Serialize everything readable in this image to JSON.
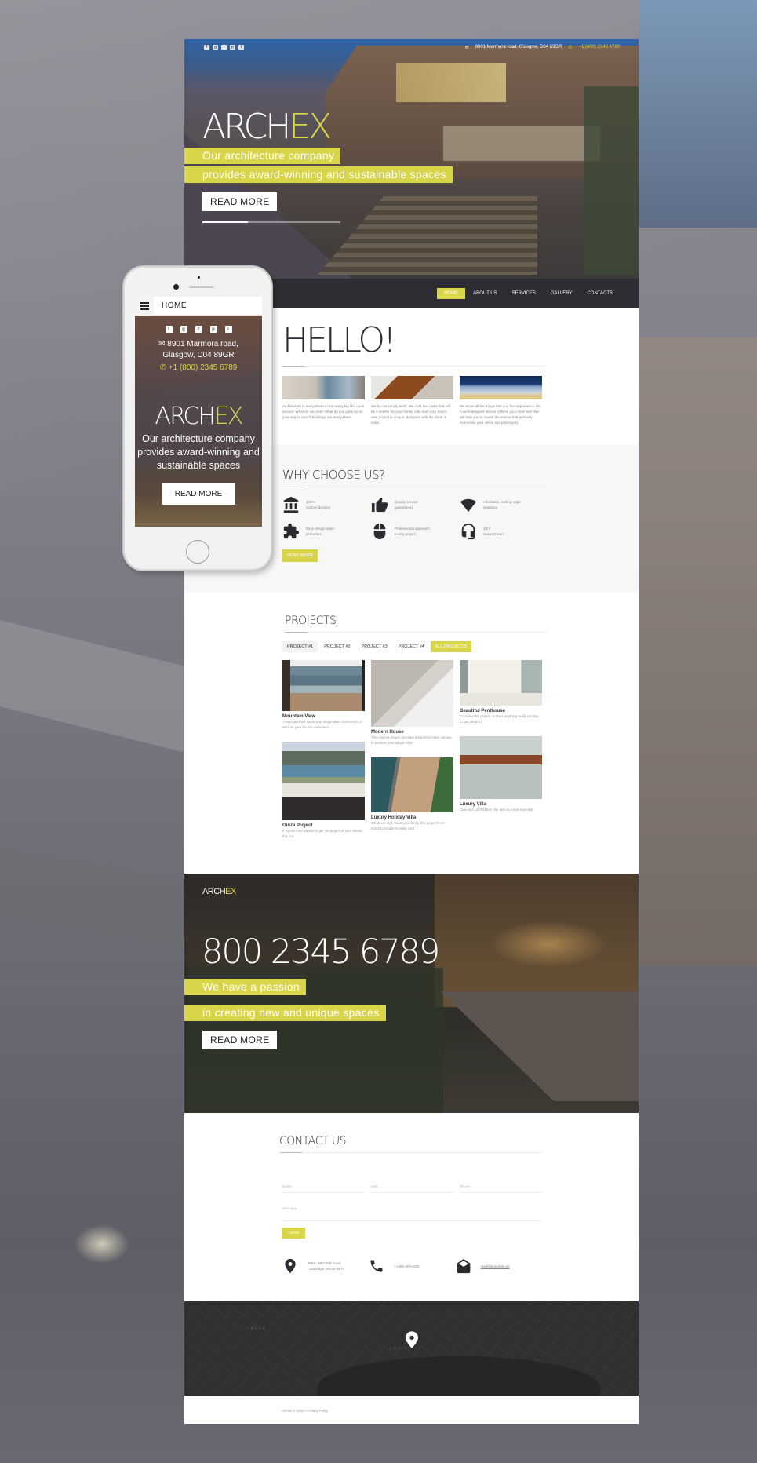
{
  "brand": {
    "logo_main": "ARCH",
    "logo_accent": "EX",
    "accent_color": "#d9d548"
  },
  "topbar": {
    "socials": [
      {
        "icon": "facebook-icon",
        "glyph": "f"
      },
      {
        "icon": "google-plus-icon",
        "glyph": "g"
      },
      {
        "icon": "twitter-icon",
        "glyph": "t"
      },
      {
        "icon": "pinterest-icon",
        "glyph": "p"
      },
      {
        "icon": "instagram-icon",
        "glyph": "i"
      }
    ],
    "address": "8901 Marmora road, Glasgow, D04 89GR",
    "phone": "+1 (800) 2345 6789"
  },
  "hero": {
    "tagline_1": "Our architecture company",
    "tagline_2": "provides award-winning and sustainable spaces",
    "button": "READ MORE"
  },
  "nav": {
    "items": [
      "HOME",
      "ABOUT US",
      "SERVICES",
      "GALLERY",
      "CONTACTS"
    ],
    "active": "HOME"
  },
  "hello": {
    "title": "HELLO!",
    "columns": [
      "Architecture is everywhere in the everyday life. Look around. What do you see? What do you pass by on your way to work? Buildings are everywhere.",
      "We do not simply build. We craft the castle that will be a shelter for your family, safe and cozy. Every new project is unique, designed with the client in mind.",
      "We know all the things that you find important in life. A well-designed interior reflects your inner self. We will help you to create the interior that perfectly expresses your views and philosophy."
    ]
  },
  "why": {
    "title": "WHY CHOOSE US?",
    "features": [
      {
        "icon": "bank-icon",
        "text": "100%\ncustom designs"
      },
      {
        "icon": "thumbs-up-icon",
        "text": "Quality service\nguaranteed."
      },
      {
        "icon": "wifi-icon",
        "text": "Affordable, cutting-edge\nsolutions."
      },
      {
        "icon": "puzzle-icon",
        "text": "Easy design order\nprocedure."
      },
      {
        "icon": "mouse-icon",
        "text": "Professional approach\nto any project"
      },
      {
        "icon": "headset-icon",
        "text": "24/7\nSupport team"
      }
    ],
    "button": "READ MORE"
  },
  "projects": {
    "title": "PROJECTS",
    "tabs": [
      "PROJECT #1",
      "PROJECT #2",
      "PROJECT #3",
      "PROJECT #4",
      "ALL PROJECTS"
    ],
    "active_tab": "ALL PROJECTS",
    "items": [
      {
        "title": "Mountain View",
        "desc": "This project will spark your imagination. Even more, it will turn your life into adventure."
      },
      {
        "title": "Modern House",
        "desc": "This original project provides the perfect blank canvas to express your unique style."
      },
      {
        "title": "Beautiful Penthouse",
        "desc": "Consider this project. Is there anything really exciting to say about it?"
      },
      {
        "title": "Ginza Project",
        "desc": "If you've ever wanted to get the project of your dream, this it is."
      },
      {
        "title": "Luxury Holiday Villa",
        "desc": "Whatever style floats your fancy, this project from trusted provider is really cool."
      },
      {
        "title": "Luxury Villa",
        "desc": "Cute and comfortable, the item is a true essential."
      }
    ]
  },
  "cta": {
    "phone": "800 2345 6789",
    "tagline_1": "We have a passion",
    "tagline_2": "in creating new and unique spaces",
    "button": "READ MORE"
  },
  "contact": {
    "title": "CONTACT US",
    "placeholders": {
      "name": "Name",
      "mail": "Mail",
      "phone": "Phone",
      "message": "Message"
    },
    "send": "SEND",
    "address": "9863 - 9867 Mill Road,\nCambridge, MG09 99HT",
    "phone": "+1 800 603 6035",
    "email": "mail@demolink.org"
  },
  "map": {
    "labels": [
      "TEXAS",
      "LOUIS"
    ]
  },
  "footer": {
    "text": "Archex © 2015 • Privacy Policy"
  },
  "mobile": {
    "menu_title": "HOME",
    "address_1": "8901 Marmora road,",
    "address_2": "Glasgow, D04 89GR",
    "phone": "+1 (800) 2345 6789",
    "tagline": "Our architecture company provides award-winning and sustainable spaces",
    "button": "READ MORE"
  }
}
